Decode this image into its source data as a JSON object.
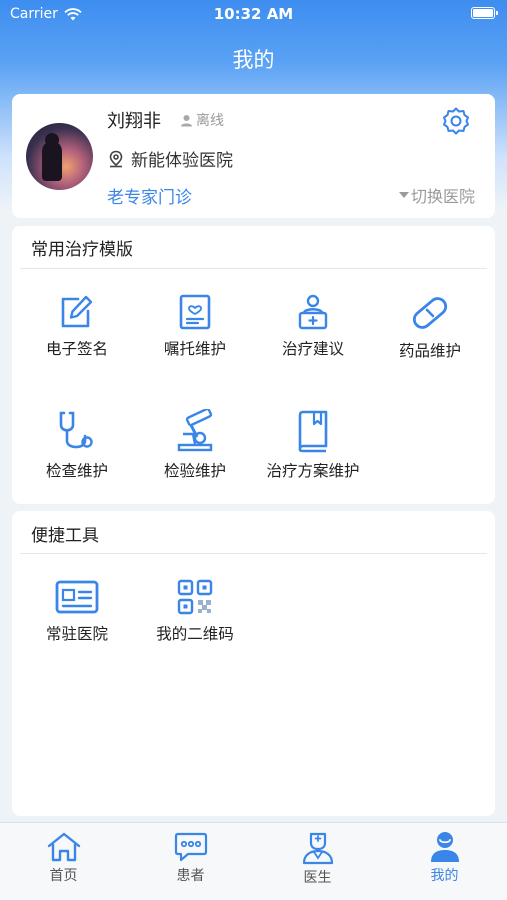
{
  "status_bar": {
    "carrier": "Carrier",
    "time": "10:32 AM"
  },
  "nav": {
    "title": "我的"
  },
  "profile": {
    "name": "刘翔非",
    "status": "离线",
    "hospital": "新能体验医院",
    "department": "老专家门诊",
    "switch_hospital": "切换医院"
  },
  "templates": {
    "title": "常用治疗模版",
    "items": [
      {
        "label": "电子签名",
        "icon": "edit-signature-icon"
      },
      {
        "label": "嘱托维护",
        "icon": "advice-card-icon"
      },
      {
        "label": "治疗建议",
        "icon": "doctor-kit-icon"
      },
      {
        "label": "药品维护",
        "icon": "pill-icon"
      },
      {
        "label": "检查维护",
        "icon": "stethoscope-icon"
      },
      {
        "label": "检验维护",
        "icon": "microscope-icon"
      },
      {
        "label": "治疗方案维护",
        "icon": "book-icon"
      }
    ]
  },
  "tools": {
    "title": "便捷工具",
    "items": [
      {
        "label": "常驻医院",
        "icon": "id-card-icon"
      },
      {
        "label": "我的二维码",
        "icon": "qr-code-icon"
      }
    ]
  },
  "tabbar": {
    "items": [
      {
        "label": "首页",
        "icon": "home-icon",
        "active": false
      },
      {
        "label": "患者",
        "icon": "chat-icon",
        "active": false
      },
      {
        "label": "医生",
        "icon": "doctor-icon",
        "active": false
      },
      {
        "label": "我的",
        "icon": "profile-icon",
        "active": true
      }
    ]
  },
  "colors": {
    "accent": "#3a86e8",
    "header": "#3d8df0"
  }
}
